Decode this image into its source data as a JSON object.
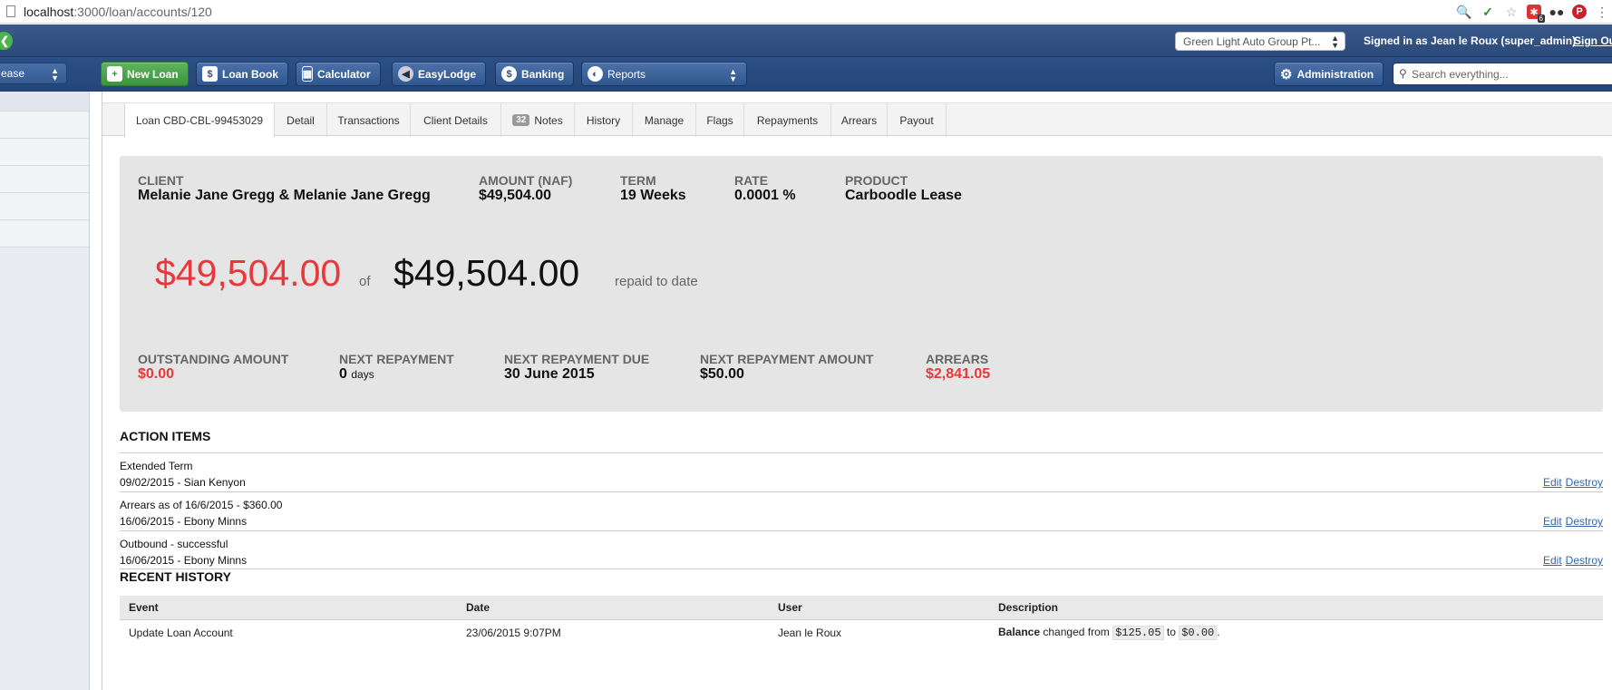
{
  "browser": {
    "url_host": "localhost",
    "url_path": ":3000/loan/accounts/120",
    "extension_icons": [
      "search-icon",
      "check-icon",
      "star-icon",
      "bookmark-icon",
      "spy-icon",
      "pinterest-icon",
      "more-icon"
    ],
    "extension_badge": "6"
  },
  "topbar": {
    "company": "Green Light Auto Group Pt...",
    "signed_in": "Signed in as Jean le Roux (super_admin)",
    "sign_out": "Sign Out"
  },
  "toolbar": {
    "left_select": "ease",
    "new_loan": "New Loan",
    "loan_book": "Loan Book",
    "calculator": "Calculator",
    "easylodge": "EasyLodge",
    "banking": "Banking",
    "reports": "Reports",
    "administration": "Administration",
    "search_placeholder": "Search everything..."
  },
  "tabs": {
    "loan": "Loan CBD-CBL-99453029",
    "detail": "Detail",
    "transactions": "Transactions",
    "client_details": "Client Details",
    "notes_count": "32",
    "notes": "Notes",
    "history": "History",
    "manage": "Manage",
    "flags": "Flags",
    "repayments": "Repayments",
    "arrears": "Arrears",
    "payout": "Payout"
  },
  "summary": {
    "client_label": "CLIENT",
    "client_value": "Melanie Jane Gregg & Melanie Jane Gregg",
    "amount_label": "AMOUNT (NAF)",
    "amount_value": "$49,504.00",
    "term_label": "TERM",
    "term_value": "19 Weeks",
    "rate_label": "RATE",
    "rate_value": "0.0001 %",
    "product_label": "PRODUCT",
    "product_value": "Carboodle Lease",
    "repaid_amount": "$49,504.00",
    "of_text": "of",
    "total_amount": "$49,504.00",
    "repaid_text": "repaid to date",
    "outstanding_label": "OUTSTANDING AMOUNT",
    "outstanding_value": "$0.00",
    "next_repayment_label": "NEXT REPAYMENT",
    "next_repayment_value": "0",
    "next_repayment_unit": "days",
    "next_due_label": "NEXT REPAYMENT DUE",
    "next_due_value": "30 June 2015",
    "next_amount_label": "NEXT REPAYMENT AMOUNT",
    "next_amount_value": "$50.00",
    "arrears_label": "ARREARS",
    "arrears_value": "$2,841.05"
  },
  "action_items": {
    "title": "ACTION ITEMS",
    "edit": "Edit",
    "destroy": "Destroy",
    "items": [
      {
        "title": "Extended Term",
        "meta": "09/02/2015 - Sian Kenyon"
      },
      {
        "title": "Arrears as of 16/6/2015 - $360.00",
        "meta": "16/06/2015 - Ebony Minns"
      },
      {
        "title": "Outbound - successful",
        "meta": "16/06/2015 - Ebony Minns"
      }
    ]
  },
  "recent_history": {
    "title": "RECENT HISTORY",
    "headers": [
      "Event",
      "Date",
      "User",
      "Description"
    ],
    "rows": [
      {
        "event": "Update Loan Account",
        "date": "23/06/2015 9:07PM",
        "user": "Jean le Roux",
        "desc_field": "Balance",
        "desc_changed": "changed from",
        "desc_from": "$125.05",
        "desc_to_word": "to",
        "desc_to": "$0.00",
        "desc_end": "."
      }
    ]
  }
}
